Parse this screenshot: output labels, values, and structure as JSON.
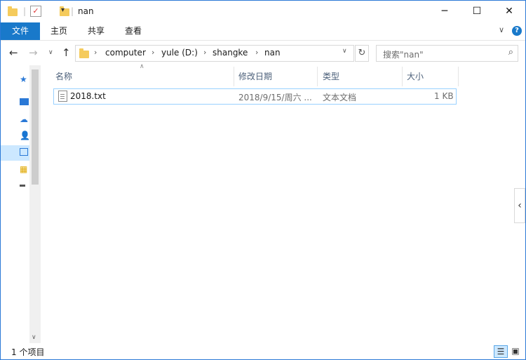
{
  "window": {
    "title": "nan"
  },
  "ribbon": {
    "tabs": [
      "文件",
      "主页",
      "共享",
      "查看"
    ]
  },
  "address": {
    "crumbs": [
      "computer",
      "yule (D:)",
      "shangke",
      "nan"
    ],
    "search_placeholder": "搜索\"nan\""
  },
  "columns": {
    "name": "名称",
    "modified": "修改日期",
    "type": "类型",
    "size": "大小"
  },
  "files": [
    {
      "name": "2018.txt",
      "modified": "2018/9/15/周六 ...",
      "type": "文本文档",
      "size": "1 KB"
    }
  ],
  "status": {
    "item_count": "1 个项目"
  },
  "colors": {
    "accent": "#1979ca",
    "selection": "#cce8ff",
    "border": "#2b79d6"
  },
  "icons": {
    "folder": "folder-icon",
    "properties": "properties-icon",
    "new_folder": "new-folder-icon",
    "back": "arrow-left-icon",
    "forward": "arrow-right-icon",
    "up": "arrow-up-icon",
    "refresh": "refresh-icon",
    "search": "search-icon",
    "text_file": "text-file-icon"
  }
}
